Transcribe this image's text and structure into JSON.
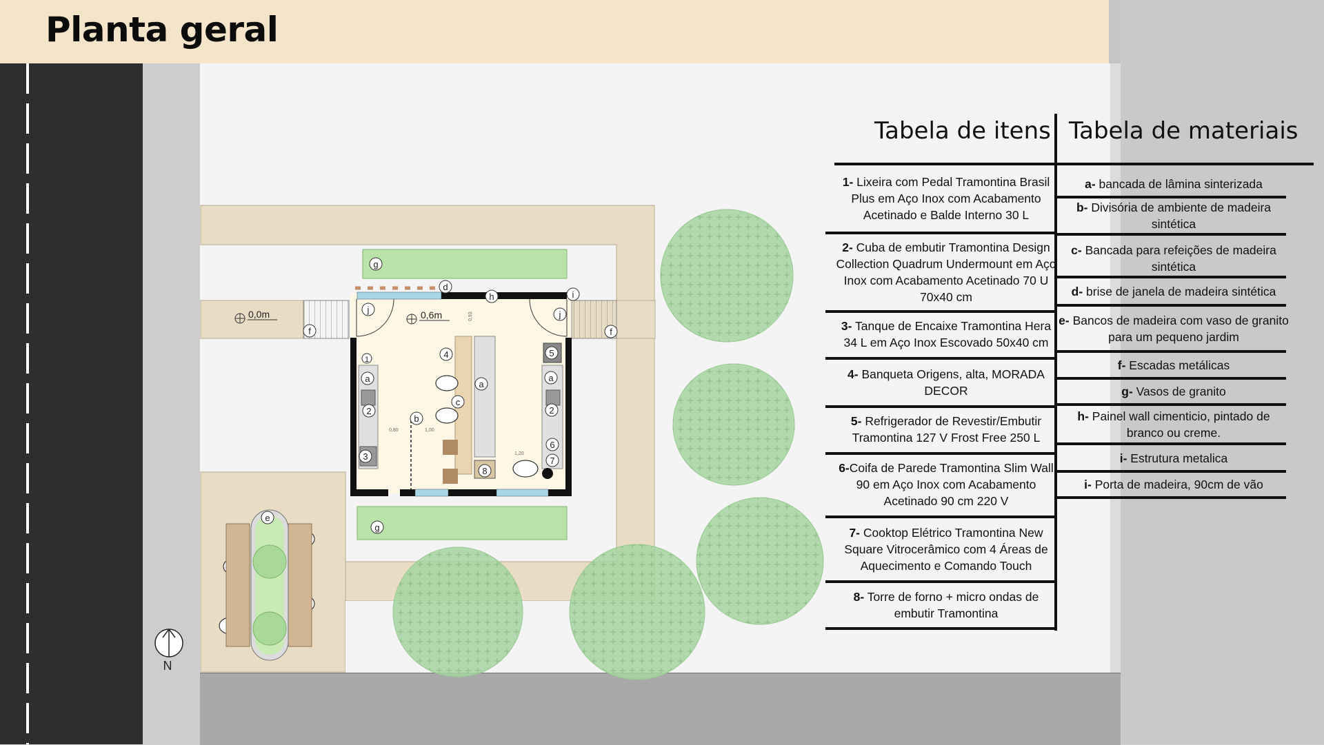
{
  "header": {
    "title": "Planta geral"
  },
  "plan": {
    "levels": [
      "0,0m",
      "0,6m"
    ],
    "markers": [
      "a",
      "b",
      "c",
      "d",
      "e",
      "f",
      "g",
      "h",
      "i",
      "j",
      "1",
      "2",
      "3",
      "4",
      "5",
      "6",
      "7",
      "8"
    ],
    "north_label": "N",
    "dims": [
      "0,80",
      "1,00",
      "1,20",
      "0,93"
    ]
  },
  "items_table": {
    "title": "Tabela de itens",
    "rows": [
      {
        "code": "1-",
        "text": " Lixeira com Pedal Tramontina Brasil Plus em Aço Inox com Acabamento Acetinado e Balde Interno 30 L"
      },
      {
        "code": "2-",
        "text": " Cuba de embutir Tramontina Design Collection Quadrum Undermount em Aço Inox com Acabamento Acetinado 70 U 70x40 cm"
      },
      {
        "code": "3-",
        "text": " Tanque de Encaixe Tramontina Hera 34 L em Aço Inox Escovado 50x40 cm"
      },
      {
        "code": "4-",
        "text": " Banqueta Origens, alta, MORADA DECOR"
      },
      {
        "code": "5-",
        "text": " Refrigerador de Revestir/Embutir Tramontina 127 V Frost Free 250 L"
      },
      {
        "code": "6-",
        "text": "Coifa de Parede Tramontina Slim Wall 90 em Aço Inox com Acabamento Acetinado 90 cm 220 V"
      },
      {
        "code": "7-",
        "text": " Cooktop Elétrico Tramontina New Square Vitrocerâmico com 4 Áreas de Aquecimento e Comando Touch"
      },
      {
        "code": "8-",
        "text": " Torre de forno + micro ondas de embutir Tramontina"
      }
    ]
  },
  "materials_table": {
    "title": "Tabela de materiais",
    "rows": [
      {
        "code": "a-",
        "text": " bancada de lâmina sinterizada"
      },
      {
        "code": "b-",
        "text": " Divisória de ambiente de madeira sintética"
      },
      {
        "code": "c-",
        "text": " Bancada para refeições de madeira sintética"
      },
      {
        "code": "d-",
        "text": " brise de janela de madeira sintética"
      },
      {
        "code": "e-",
        "text": " Bancos de madeira com vaso de granito para um pequeno jardim"
      },
      {
        "code": "f-",
        "text": " Escadas metálicas"
      },
      {
        "code": "g-",
        "text": " Vasos de granito"
      },
      {
        "code": "h-",
        "text": " Painel wall cimenticio, pintado de branco ou creme."
      },
      {
        "code": "i-",
        "text": " Estrutura metalica"
      },
      {
        "code": "i-",
        "text": " Porta de madeira, 90cm de vão"
      }
    ]
  },
  "colors": {
    "header_bg": "#f4e4c9",
    "road": "#2e2e2e",
    "kitchen_floor": "#fff7e6",
    "paving": "#e9dcc4",
    "tree": "#9ed49a",
    "planter": "#b9e3a8"
  }
}
